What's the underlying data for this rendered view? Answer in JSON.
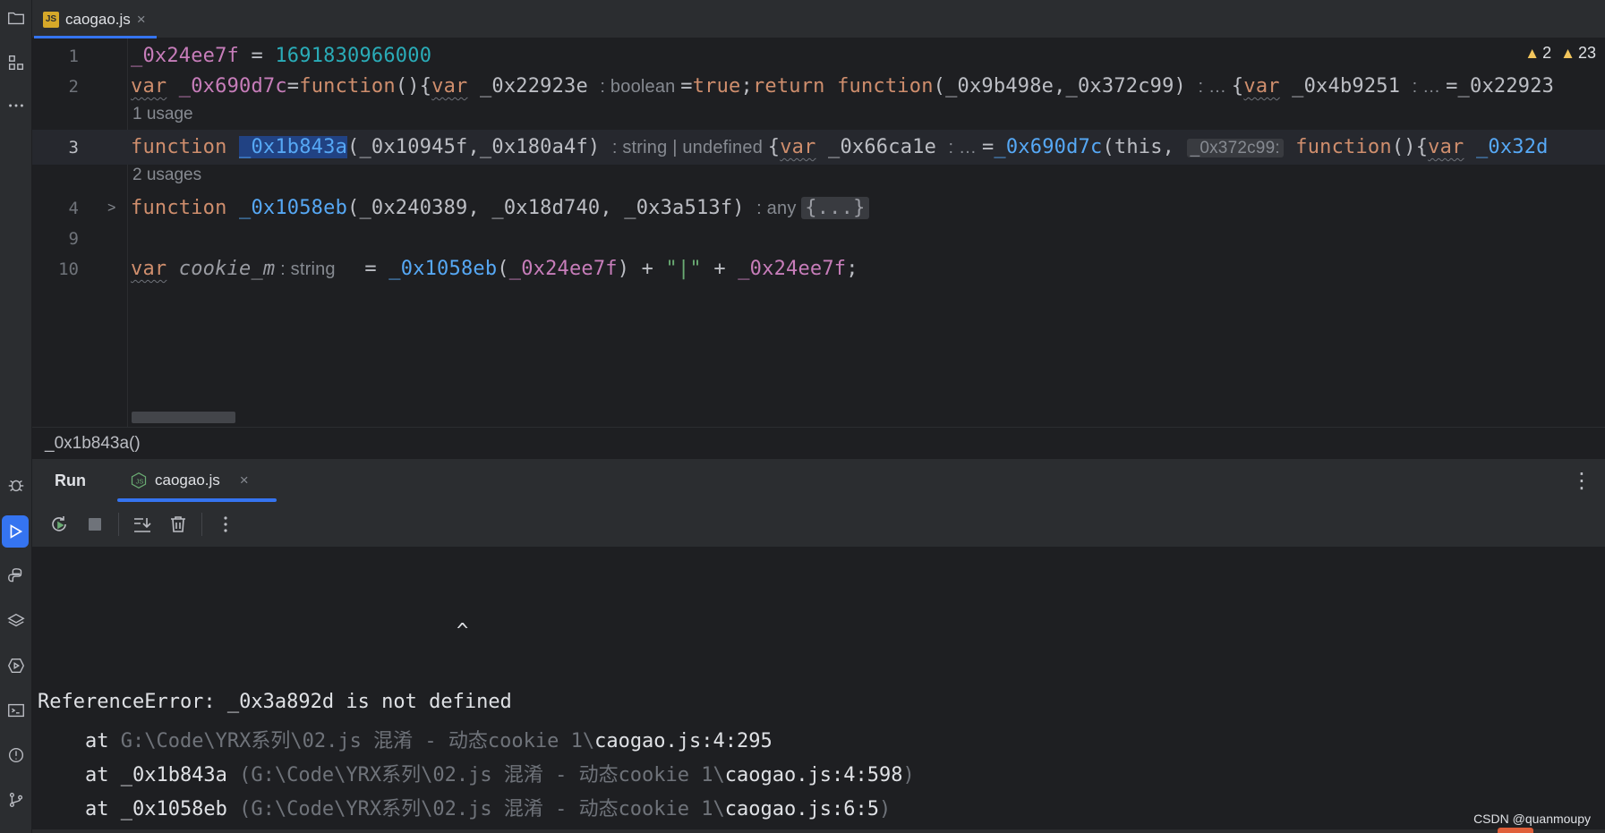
{
  "editor_tab": {
    "badge": "JS",
    "label": "caogao.js",
    "close": "×"
  },
  "warnings": {
    "count_a": "2",
    "count_b": "23"
  },
  "code": {
    "line1": {
      "num": "1",
      "v": "_0x24ee7f",
      "eq": " = ",
      "n": "1691830966000"
    },
    "line2": {
      "num": "2",
      "t1": "var",
      "t2": " _0x690d7c",
      "t3": "=",
      "t4": "function",
      "t5": "(){",
      "t6": "var",
      "t7": " _0x22923e ",
      "h1": ": boolean ",
      "t8": "=",
      "t9": "true",
      "t10": ";",
      "t11": "return",
      "t12": " ",
      "t13": "function",
      "t14": "(_0x9b498e,_0x372c99) ",
      "h2": ": … ",
      "t15": "{",
      "t16": "var",
      "t17": " _0x4b9251 ",
      "h3": ": … ",
      "t18": "=_0x22923"
    },
    "usage1": "1 usage",
    "line3": {
      "num": "3",
      "t1": "function",
      "t2": " ",
      "t3": "_0x1b843a",
      "t4": "(_0x10945f,_0x180a4f) ",
      "h1": ": string | undefined ",
      "t5": "{",
      "t6": "var",
      "t7": " _0x66ca1e ",
      "h2": ": … ",
      "t8": "=",
      "t9": "_0x690d7c",
      "t10": "(this, ",
      "h3": "_0x372c99:",
      "t11": " ",
      "t12": "function",
      "t13": "(){",
      "t14": "var",
      "t15": " _0x32d"
    },
    "usage2": "2 usages",
    "line4": {
      "num": "4",
      "fold": ">",
      "t1": "function",
      "t2": " ",
      "t3": "_0x1058eb",
      "t4": "(_0x240389, _0x18d740, _0x3a513f) ",
      "h1": ": any ",
      "t5": "{...}"
    },
    "line9": {
      "num": "9"
    },
    "line10": {
      "num": "10",
      "t1": "var",
      "t2": " ",
      "t3": "cookie_m",
      "h1": " : string ",
      "t4": "  = ",
      "t5": "_0x1058eb",
      "t6": "(",
      "t7": "_0x24ee7f",
      "t8": ") + ",
      "t9": "\"|\"",
      "t10": " + ",
      "t11": "_0x24ee7f",
      "t12": ";"
    }
  },
  "breadcrumb": "_0x1b843a()",
  "run_panel": {
    "title": "Run",
    "tab_label": "caogao.js",
    "tab_close": "×",
    "more": "⋮"
  },
  "console": {
    "caret": "^",
    "error": "ReferenceError: _0x3a892d is not defined",
    "st1_at": "    at ",
    "st1_path": "G:\\Code\\YRX系列\\02.js 混淆 - 动态cookie 1\\",
    "st1_file": "caogao.js:4:295",
    "st2_at": "    at _0x1b843a ",
    "st2_path": "(G:\\Code\\YRX系列\\02.js 混淆 - 动态cookie 1\\",
    "st2_file": "caogao.js:4:598",
    "st2_end": ")",
    "st3_at": "    at _0x1058eb ",
    "st3_path": "(G:\\Code\\YRX系列\\02.js 混淆 - 动态cookie 1\\",
    "st3_file": "caogao.js:6:5",
    "st3_end": ")"
  },
  "watermark": "CSDN @quanmoupy",
  "colors": {
    "accent": "#3574f0",
    "keyword": "#cf8e6d",
    "function": "#56a8f5",
    "variable": "#c77dba",
    "number": "#2aacb8",
    "string": "#6aab73",
    "warning": "#f2c55c"
  },
  "icons": [
    "folder-icon",
    "structure-icon",
    "more-icon",
    "debug-icon",
    "run-icon",
    "python-icon",
    "layers-icon",
    "services-icon",
    "terminal-icon",
    "problems-icon",
    "git-icon",
    "rerun-icon",
    "stop-icon",
    "scroll-to-end-icon",
    "trash-icon",
    "node-icon"
  ]
}
